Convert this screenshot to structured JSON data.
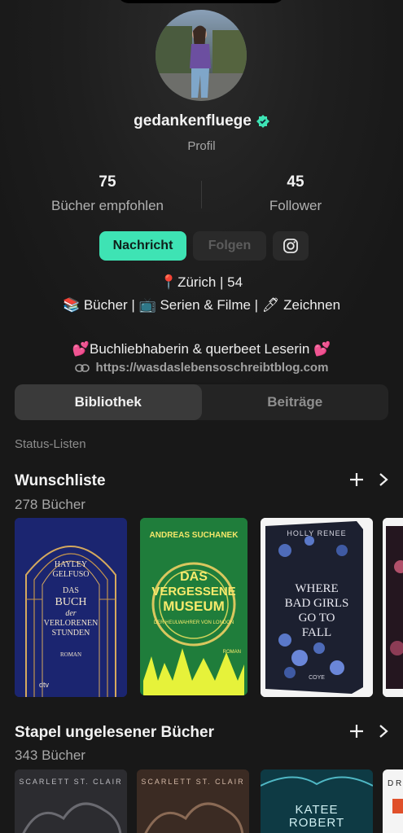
{
  "profile": {
    "username": "gedankenfluege",
    "subtitle": "Profil",
    "stats": [
      {
        "value": "75",
        "label": "Bücher empfohlen"
      },
      {
        "value": "45",
        "label": "Follower"
      }
    ],
    "buttons": {
      "message": "Nachricht",
      "follow": "Folgen"
    },
    "bio": {
      "line1": "📍Zürich | 54",
      "line2": "📚 Bücher | 📺 Serien & Filme | 🖊 Zeichnen",
      "line3": "💕Buchliebhaberin & querbeet Leserin 💕",
      "link": "https://wasdaslebensoschreibtblog.com"
    },
    "accent_color": "#3ee3b4"
  },
  "tabs": [
    {
      "label": "Bibliothek",
      "active": true
    },
    {
      "label": "Beiträge",
      "active": false
    }
  ],
  "status_section_label": "Status-Listen",
  "lists": [
    {
      "title": "Wunschliste",
      "count": "278 Bücher",
      "books": [
        {
          "title_lines": [
            "HAYLEY",
            "GELFUSO",
            "DAS",
            "BUCH",
            "der",
            "VERLORENEN",
            "STUNDEN"
          ],
          "tag": "ROMAN",
          "publisher": "dtv"
        },
        {
          "author": "ANDREAS SUCHANEK",
          "title_lines": [
            "DAS",
            "VERGESSENE",
            "MUSEUM"
          ],
          "subtitle": "DER HEULWAHRER VON LONDON",
          "tag": "ROMAN"
        },
        {
          "author": "HOLLY RENEE",
          "title_lines": [
            "WHERE",
            "BAD GIRLS",
            "GO TO",
            "FALL"
          ],
          "publisher": "COYE"
        }
      ]
    },
    {
      "title": "Stapel ungelesener Bücher",
      "count": "343 Bücher",
      "books": [
        {
          "author": "SCARLETT ST. CLAIR"
        },
        {
          "author": "SCARLETT ST. CLAIR"
        },
        {
          "title_lines": [
            "KATEE",
            "ROBERT"
          ]
        },
        {
          "author": "D R"
        }
      ]
    }
  ]
}
